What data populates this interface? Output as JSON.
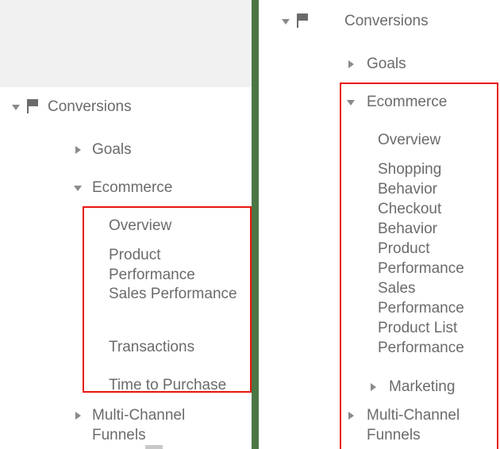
{
  "colors": {
    "text": "#6b6b6b",
    "arrow": "#8a8a8a",
    "highlight": "#e8140f",
    "green_edge": "#4d7645",
    "shade": "#f0f1f0"
  },
  "left_panel": {
    "name": "google-analytics-sidebar-old",
    "items": [
      {
        "label": "Conversions",
        "state": "expanded",
        "icon": "flag-icon",
        "indent": 0
      },
      {
        "label": "Goals",
        "state": "collapsed",
        "icon": "chevron-right-icon",
        "indent": 1
      },
      {
        "label": "Ecommerce",
        "state": "expanded",
        "icon": "chevron-down-icon",
        "indent": 1
      },
      {
        "label": "Overview",
        "state": "leaf",
        "icon": "none",
        "indent": 2
      },
      {
        "label": "Product Performance",
        "state": "leaf",
        "icon": "none",
        "indent": 2
      },
      {
        "label": "Sales Performance",
        "state": "leaf",
        "icon": "none",
        "indent": 2
      },
      {
        "label": "Transactions",
        "state": "leaf",
        "icon": "none",
        "indent": 2
      },
      {
        "label": "Time to Purchase",
        "state": "leaf",
        "icon": "none",
        "indent": 2
      },
      {
        "label": "Multi-Channel Funnels",
        "state": "collapsed",
        "icon": "chevron-right-icon",
        "indent": 0
      }
    ]
  },
  "right_panel": {
    "name": "google-analytics-sidebar-new",
    "items": [
      {
        "label": "Conversions",
        "state": "expanded",
        "icon": "flag-icon",
        "indent": 0
      },
      {
        "label": "Goals",
        "state": "collapsed",
        "icon": "chevron-right-icon",
        "indent": 1
      },
      {
        "label": "Ecommerce",
        "state": "expanded",
        "icon": "chevron-down-icon",
        "indent": 1
      },
      {
        "label": "Overview",
        "state": "leaf",
        "icon": "none",
        "indent": 2
      },
      {
        "label": "Shopping Behavior",
        "state": "leaf",
        "icon": "none",
        "indent": 2
      },
      {
        "label": "Checkout Behavior",
        "state": "leaf",
        "icon": "none",
        "indent": 2
      },
      {
        "label": "Product Performance",
        "state": "leaf",
        "icon": "none",
        "indent": 2
      },
      {
        "label": "Sales Performance",
        "state": "leaf",
        "icon": "none",
        "indent": 2
      },
      {
        "label": "Product List Performance",
        "state": "leaf",
        "icon": "none",
        "indent": 2
      },
      {
        "label": "Marketing",
        "state": "collapsed",
        "icon": "chevron-right-icon",
        "indent": 1
      },
      {
        "label": "Multi-Channel Funnels",
        "state": "collapsed",
        "icon": "chevron-right-icon",
        "indent": 0
      }
    ]
  },
  "annotations": {
    "left_highlight_label": "ecommerce-reports-highlight-left",
    "right_highlight_label": "ecommerce-section-highlight-right"
  }
}
